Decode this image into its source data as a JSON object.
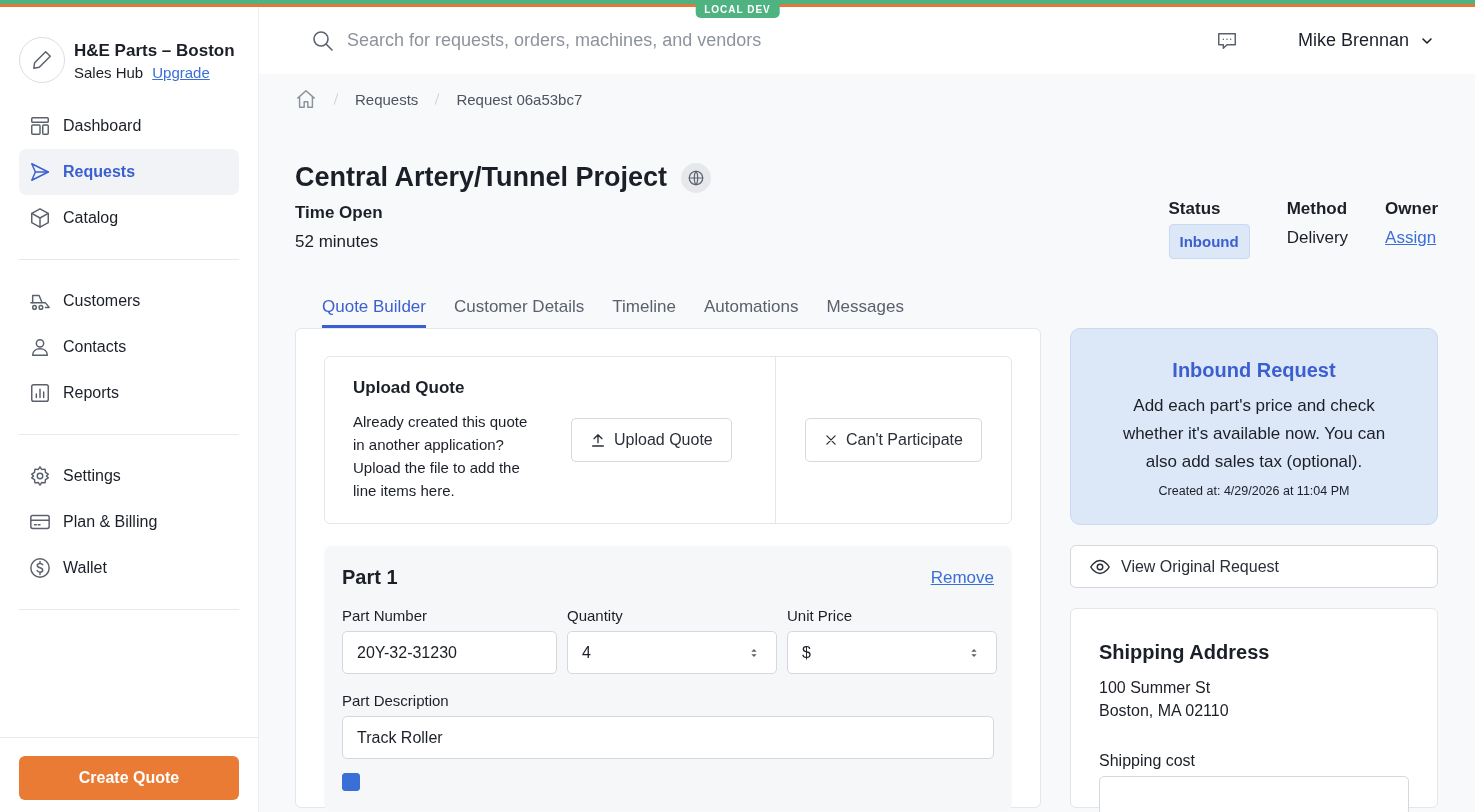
{
  "env_badge": "LOCAL DEV",
  "sidebar": {
    "org": {
      "name": "H&E Parts – Boston",
      "plan": "Sales Hub",
      "upgrade": "Upgrade"
    },
    "groups": [
      [
        {
          "label": "Dashboard",
          "selected": false
        },
        {
          "label": "Requests",
          "selected": true
        },
        {
          "label": "Catalog",
          "selected": false
        }
      ],
      [
        {
          "label": "Customers",
          "selected": false
        },
        {
          "label": "Contacts",
          "selected": false
        },
        {
          "label": "Reports",
          "selected": false
        }
      ],
      [
        {
          "label": "Settings",
          "selected": false
        },
        {
          "label": "Plan & Billing",
          "selected": false
        },
        {
          "label": "Wallet",
          "selected": false
        }
      ]
    ],
    "create_button": "Create Quote"
  },
  "header": {
    "search": {
      "placeholder": "Search for requests, orders, machines, and vendors"
    },
    "user": "Mike Brennan"
  },
  "breadcrumb": [
    "Requests",
    "Request 06a53bc7"
  ],
  "title": "Central Artery/Tunnel Project",
  "time_open": {
    "label": "Time Open",
    "value": "52 minutes"
  },
  "meta": [
    {
      "label": "Status",
      "value": "Inbound",
      "kind": "badge"
    },
    {
      "label": "Method",
      "value": "Delivery",
      "kind": "text"
    },
    {
      "label": "Owner",
      "value": "Assign",
      "kind": "link"
    }
  ],
  "tabs": [
    {
      "label": "Quote Builder",
      "selected": true
    },
    {
      "label": "Customer Details",
      "selected": false
    },
    {
      "label": "Timeline",
      "selected": false
    },
    {
      "label": "Automations",
      "selected": false
    },
    {
      "label": "Messages",
      "selected": false
    }
  ],
  "upload": {
    "title": "Upload Quote",
    "text": "Already created this quote in another application? Upload the file to add the line items here.",
    "upload_button": "Upload Quote",
    "decline_button": "Can't Participate"
  },
  "parts": [
    {
      "title": "Part 1",
      "remove": "Remove",
      "fields": [
        {
          "label": "Part Number",
          "value": "20Y-32-31230",
          "kind": "text"
        },
        {
          "label": "Quantity",
          "value": "4",
          "kind": "number"
        },
        {
          "label": "Unit Price",
          "value": "$",
          "kind": "number"
        }
      ],
      "description": {
        "label": "Part Description",
        "value": "Track Roller"
      },
      "checked": true
    }
  ],
  "info": {
    "title": "Inbound Request",
    "text": "Add each part's price and check whether it's available now. You can also add sales tax (optional).",
    "created": "Created at: 4/29/2026 at 11:04 PM"
  },
  "view_button": "View Original Request",
  "shipping": {
    "title": "Shipping Address",
    "address": [
      "100 Summer St",
      "Boston, MA 02110"
    ],
    "cost_label": "Shipping cost"
  }
}
